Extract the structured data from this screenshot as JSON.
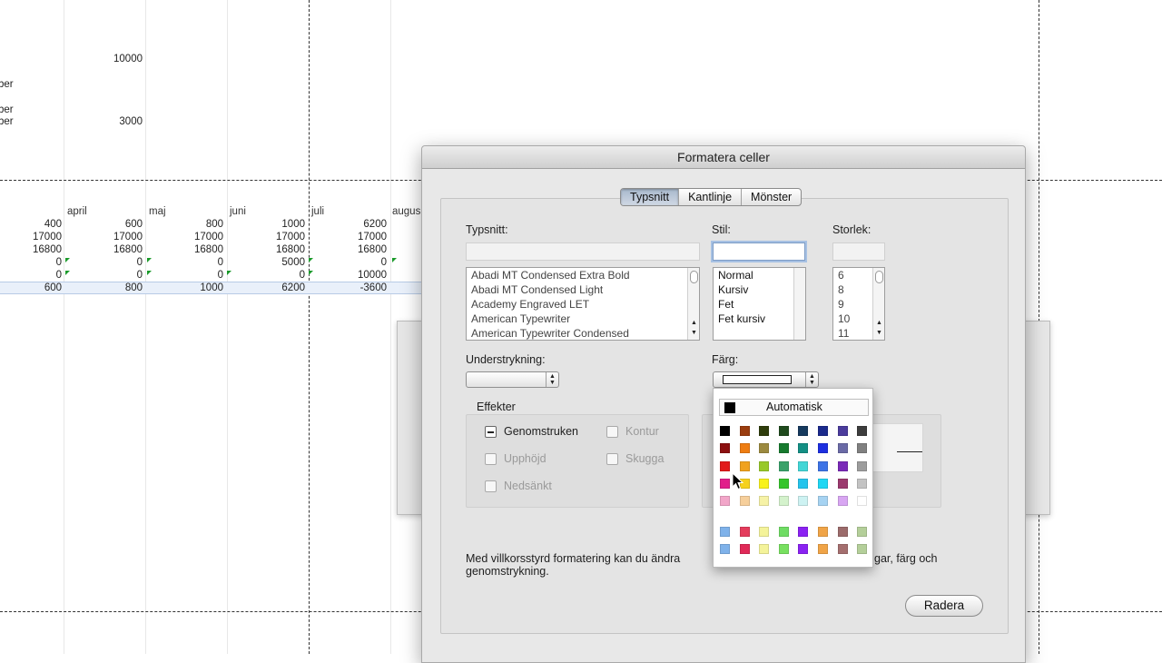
{
  "spreadsheet": {
    "values_top": [
      "10000",
      "3000"
    ],
    "row_labels": [
      "ber",
      "ber"
    ],
    "months": [
      "april",
      "maj",
      "juni",
      "juli",
      "augus"
    ],
    "rows": [
      [
        "400",
        "600",
        "800",
        "1000",
        "6200"
      ],
      [
        "17000",
        "17000",
        "17000",
        "17000",
        "17000"
      ],
      [
        "16800",
        "16800",
        "16800",
        "16800",
        "16800"
      ],
      [
        "0",
        "0",
        "0",
        "5000",
        "0"
      ],
      [
        "0",
        "0",
        "0",
        "0",
        "10000"
      ],
      [
        "600",
        "800",
        "1000",
        "6200",
        "-3600"
      ]
    ]
  },
  "dialog": {
    "title": "Formatera celler",
    "tabs": [
      "Typsnitt",
      "Kantlinje",
      "Mönster"
    ],
    "active_tab": "Typsnitt",
    "font_label": "Typsnitt:",
    "style_label": "Stil:",
    "size_label": "Storlek:",
    "font_value": "",
    "style_value": "",
    "size_value": "",
    "fonts": [
      "Abadi MT Condensed Extra Bold",
      "Abadi MT Condensed Light",
      "Academy Engraved LET",
      "American Typewriter",
      "American Typewriter Condensed"
    ],
    "styles": [
      "Normal",
      "Kursiv",
      "Fet",
      "Fet kursiv"
    ],
    "sizes": [
      "6",
      "8",
      "9",
      "10",
      "11"
    ],
    "underline_label": "Understrykning:",
    "underline_value": "",
    "color_label": "Färg:",
    "effects_label": "Effekter",
    "effects": {
      "strikethrough": "Genomstruken",
      "superscript": "Upphöjd",
      "subscript": "Nedsänkt",
      "outline": "Kontur",
      "shadow": "Skugga"
    },
    "note_line1": "Med villkorsstyrd formatering kan du ändra",
    "note_line1_tail": "gar, färg och",
    "note_line2": "genomstrykning.",
    "delete_button": "Radera"
  },
  "palette": {
    "automatic_label": "Automatisk",
    "automatic_color": "#000000",
    "grid": [
      [
        "#000000",
        "#9a3d0f",
        "#2f3d0c",
        "#1f4a1d",
        "#163a5e",
        "#1b2a8c",
        "#4b3c9c",
        "#3d3d3d"
      ],
      [
        "#8c1010",
        "#ee7d12",
        "#9c8a3f",
        "#177a2e",
        "#138f84",
        "#1d2fe0",
        "#6a6aa6",
        "#808080"
      ],
      [
        "#e21b1b",
        "#f0a21e",
        "#98c92a",
        "#3aa26a",
        "#43d6d6",
        "#3d73e6",
        "#7a2ab8",
        "#9c9c9c"
      ],
      [
        "#e11f8a",
        "#f6d11e",
        "#f8f21b",
        "#36c52c",
        "#25c4ec",
        "#1fd7f4",
        "#9b3a6e",
        "#c3c3c3"
      ],
      [
        "#f2a6c9",
        "#f6cf9b",
        "#f6f2a6",
        "#d4f2cc",
        "#cdf2f2",
        "#a6d3f2",
        "#d8a6f2",
        "#ffffff"
      ]
    ],
    "recent": [
      [
        "#7fb2ea",
        "#e43c5c",
        "#f4f39a",
        "#6fdc64",
        "#8a22f2",
        "#f0a447",
        "#9b6b6b",
        "#b4cf9a"
      ],
      [
        "#7fb2ea",
        "#e02a58",
        "#f4f39a",
        "#78e060",
        "#8a22f2",
        "#f0a447",
        "#a46f6f",
        "#b4cf9a"
      ]
    ]
  }
}
